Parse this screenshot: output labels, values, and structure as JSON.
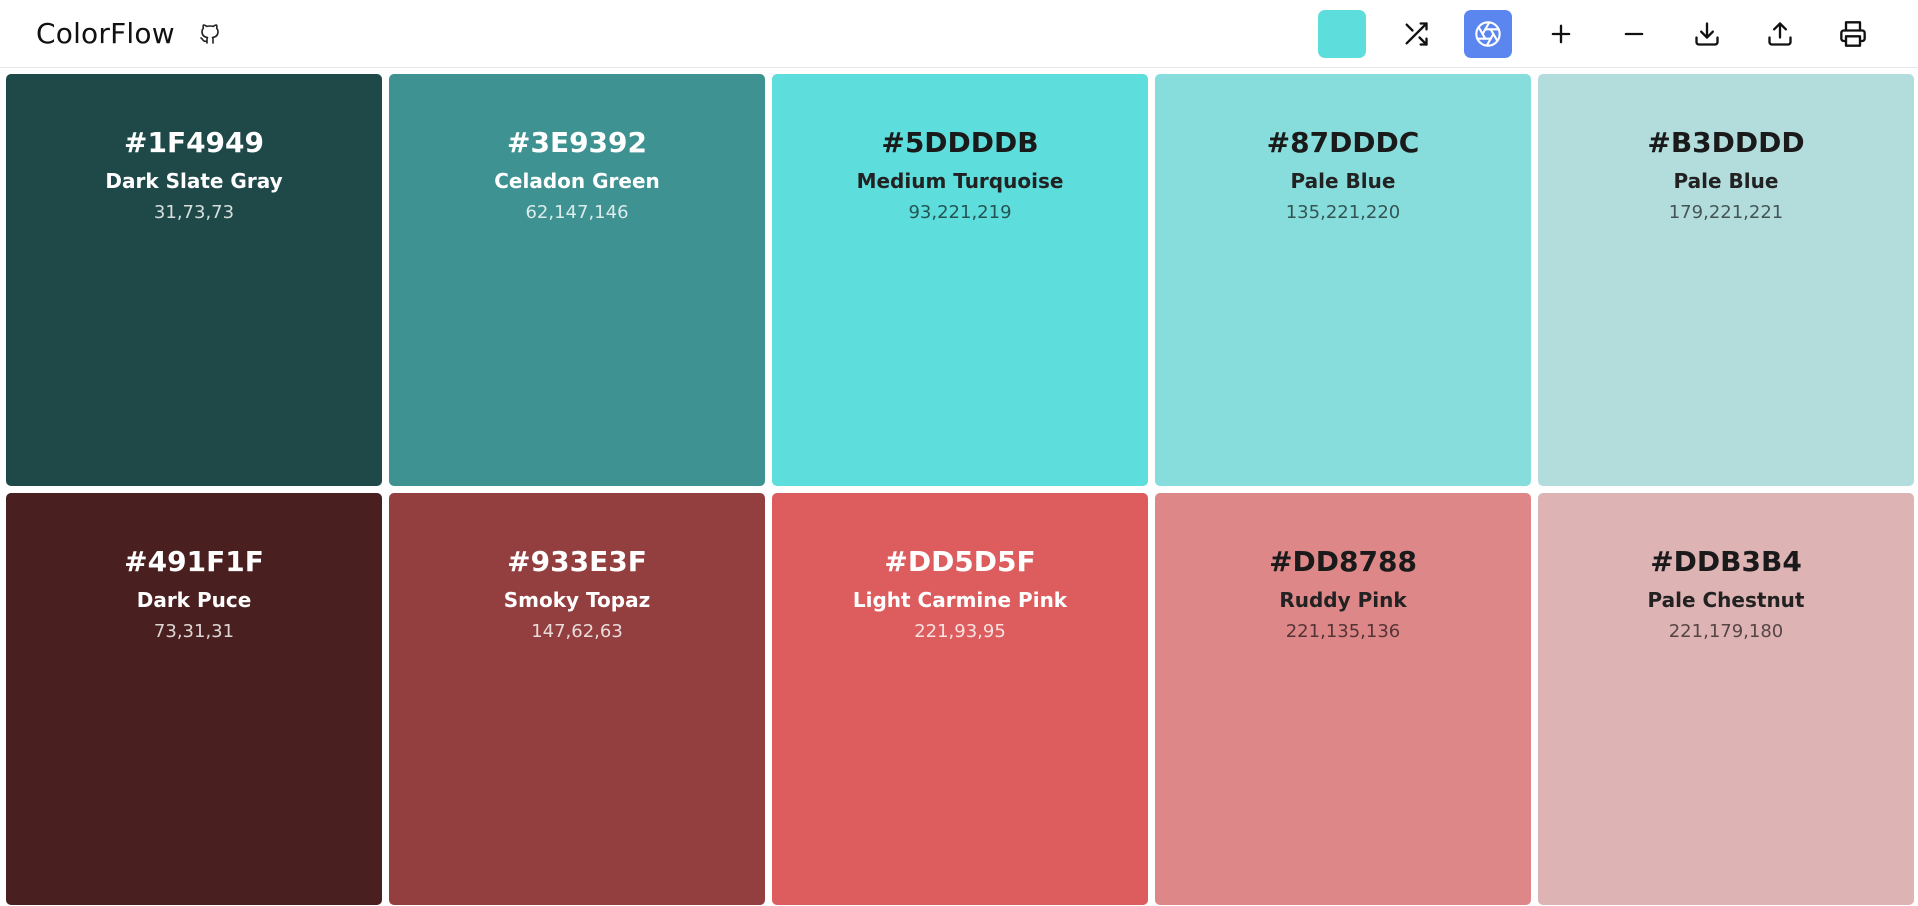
{
  "header": {
    "brand": "ColorFlow",
    "current_color": "#5DDDDB",
    "accent": "#5b86f0",
    "tools": [
      {
        "name": "current-color-swatch",
        "icon": "color-swatch"
      },
      {
        "name": "shuffle-button",
        "icon": "shuffle-icon"
      },
      {
        "name": "color-mode-button",
        "icon": "aperture-icon"
      },
      {
        "name": "add-color-button",
        "icon": "plus-icon"
      },
      {
        "name": "remove-color-button",
        "icon": "minus-icon"
      },
      {
        "name": "download-button",
        "icon": "download-icon"
      },
      {
        "name": "share-button",
        "icon": "upload-icon"
      },
      {
        "name": "print-button",
        "icon": "printer-icon"
      }
    ]
  },
  "palette": [
    {
      "hex": "#1F4949",
      "name": "Dark Slate Gray",
      "rgb": "31,73,73"
    },
    {
      "hex": "#3E9392",
      "name": "Celadon Green",
      "rgb": "62,147,146"
    },
    {
      "hex": "#5DDDDB",
      "name": "Medium Turquoise",
      "rgb": "93,221,219"
    },
    {
      "hex": "#87DDDC",
      "name": "Pale Blue",
      "rgb": "135,221,220"
    },
    {
      "hex": "#B3DDDD",
      "name": "Pale Blue",
      "rgb": "179,221,221"
    },
    {
      "hex": "#491F1F",
      "name": "Dark Puce",
      "rgb": "73,31,31"
    },
    {
      "hex": "#933E3F",
      "name": "Smoky Topaz",
      "rgb": "147,62,63"
    },
    {
      "hex": "#DD5D5F",
      "name": "Light Carmine Pink",
      "rgb": "221,93,95"
    },
    {
      "hex": "#DD8788",
      "name": "Ruddy Pink",
      "rgb": "221,135,136"
    },
    {
      "hex": "#DDB3B4",
      "name": "Pale Chestnut",
      "rgb": "221,179,180"
    }
  ]
}
